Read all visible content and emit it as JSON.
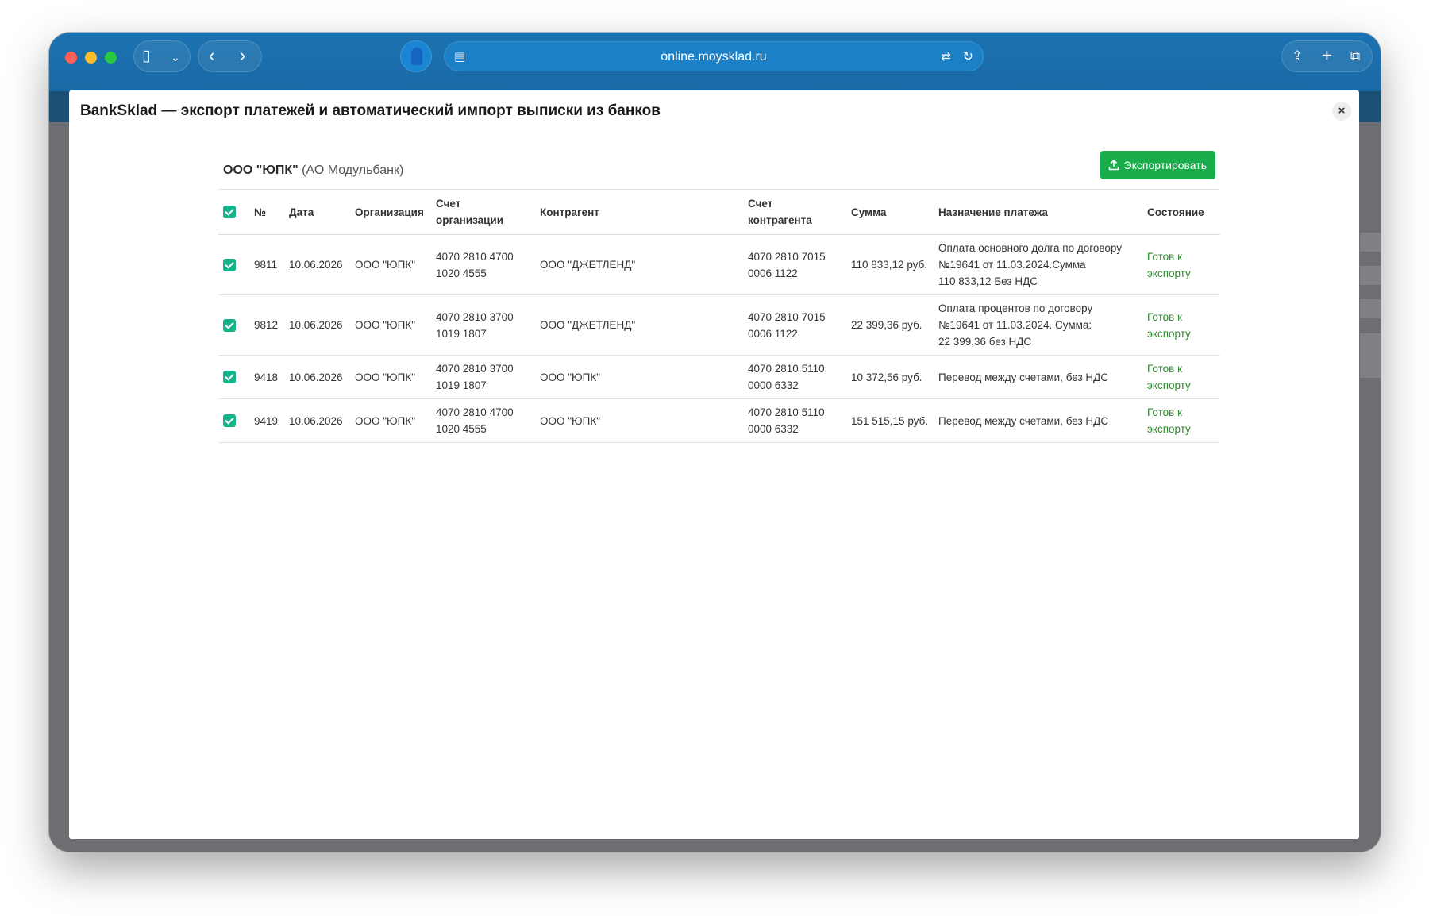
{
  "browser": {
    "url": "online.moysklad.ru"
  },
  "modal": {
    "title": "BankSklad — экспорт платежей и автоматический импорт выписки из банков",
    "close_label": "×"
  },
  "organization": {
    "name": "ООО \"ЮПК\"",
    "bank": "(АО Модульбанк)"
  },
  "export_button": {
    "label": "Экспортировать"
  },
  "table": {
    "headers": {
      "number": "№",
      "date": "Дата",
      "organization": "Организация",
      "org_account": "Счет\nорганизации",
      "counterparty": "Контрагент",
      "cp_account": "Счет\nконтрагента",
      "amount": "Сумма",
      "purpose": "Назначение платежа",
      "status": "Состояние"
    },
    "rows": [
      {
        "number": "9811",
        "date": "10.06.2026",
        "organization": "ООО \"ЮПК\"",
        "org_account": "4070 2810 4700\n1020 4555",
        "counterparty": "ООО \"ДЖЕТЛЕНД\"",
        "cp_account": "4070 2810 7015\n0006 1122",
        "amount": "110 833,12 руб.",
        "purpose": "Оплата основного долга по договору\n№19641 от 11.03.2024.Сумма\n110 833,12 Без НДС",
        "status": "Готов к\nэкспорту"
      },
      {
        "number": "9812",
        "date": "10.06.2026",
        "organization": "ООО \"ЮПК\"",
        "org_account": "4070 2810 3700\n1019 1807",
        "counterparty": "ООО \"ДЖЕТЛЕНД\"",
        "cp_account": "4070 2810 7015\n0006 1122",
        "amount": "22 399,36 руб.",
        "purpose": "Оплата процентов по договору\n№19641 от 11.03.2024. Сумма:\n22 399,36 без НДС",
        "status": "Готов к\nэкспорту"
      },
      {
        "number": "9418",
        "date": "10.06.2026",
        "organization": "ООО \"ЮПК\"",
        "org_account": "4070 2810 3700\n1019 1807",
        "counterparty": "ООО \"ЮПК\"",
        "cp_account": "4070 2810 5110\n0000 6332",
        "amount": "10 372,56 руб.",
        "purpose": "Перевод между счетами, без НДС",
        "status": "Готов к\nэкспорту"
      },
      {
        "number": "9419",
        "date": "10.06.2026",
        "organization": "ООО \"ЮПК\"",
        "org_account": "4070 2810 4700\n1020 4555",
        "counterparty": "ООО \"ЮПК\"",
        "cp_account": "4070 2810 5110\n0000 6332",
        "amount": "151 515,15 руб.",
        "purpose": "Перевод между счетами, без НДС",
        "status": "Готов к\nэкспорту"
      }
    ]
  },
  "colors": {
    "accent_green": "#1aad4b",
    "checkbox": "#14b38a",
    "status_green": "#2e8b2e",
    "toolbar_blue": "#1b72b1"
  }
}
